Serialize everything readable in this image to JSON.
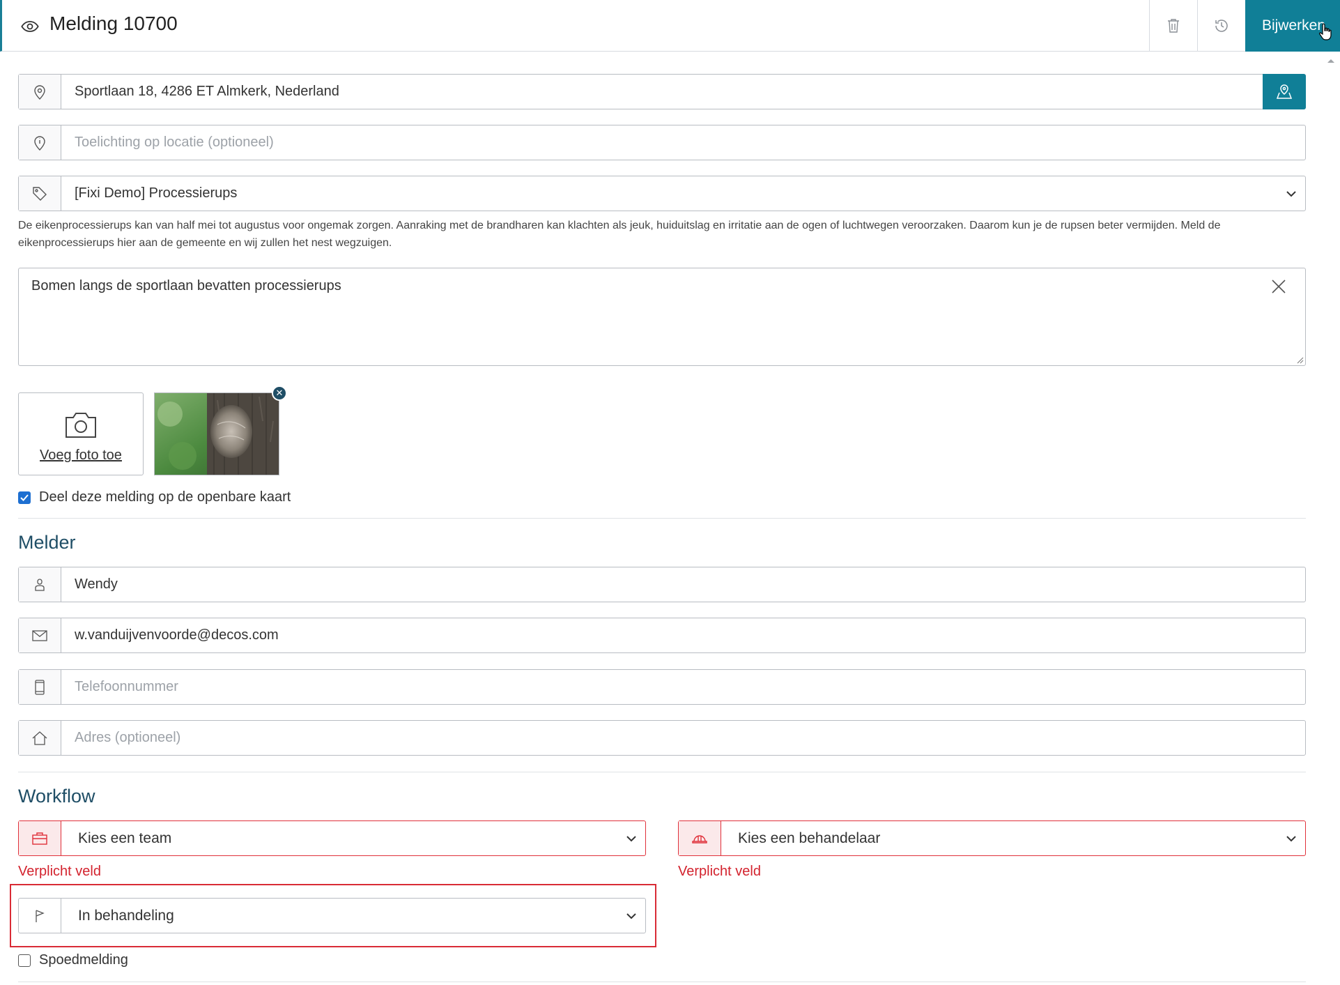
{
  "header": {
    "title": "Melding 10700",
    "update_label": "Bijwerken"
  },
  "location": {
    "address": "Sportlaan 18, 4286 ET Almkerk, Nederland",
    "explanation_placeholder": "Toelichting op locatie (optioneel)"
  },
  "category": {
    "selected": "[Fixi Demo] Processierups",
    "description": "De eikenprocessierups kan van half mei tot augustus voor ongemak zorgen. Aanraking met de brandharen kan klachten als jeuk, huiduitslag en irritatie aan de ogen of luchtwegen veroorzaken. Daarom kun je de rupsen beter vermijden. Meld de eikenprocessierups hier aan de gemeente en wij zullen het nest wegzuigen."
  },
  "message_text": "Bomen langs de sportlaan bevatten processierups",
  "photo": {
    "add_label": "Voeg foto toe"
  },
  "share_on_map": {
    "label": "Deel deze melding op de openbare kaart",
    "checked": true
  },
  "reporter": {
    "heading": "Melder",
    "name": "Wendy",
    "email": "w.vanduijvenvoorde@decos.com",
    "phone_placeholder": "Telefoonnummer",
    "address_placeholder": "Adres (optioneel)"
  },
  "workflow": {
    "heading": "Workflow",
    "team_placeholder": "Kies een team",
    "handler_placeholder": "Kies een behandelaar",
    "required_label": "Verplicht veld",
    "status": "In behandeling",
    "urgent_label": "Spoedmelding",
    "urgent_checked": false
  },
  "colors": {
    "accent": "#107f97",
    "heading": "#1f4e66",
    "error": "#d3232e"
  }
}
